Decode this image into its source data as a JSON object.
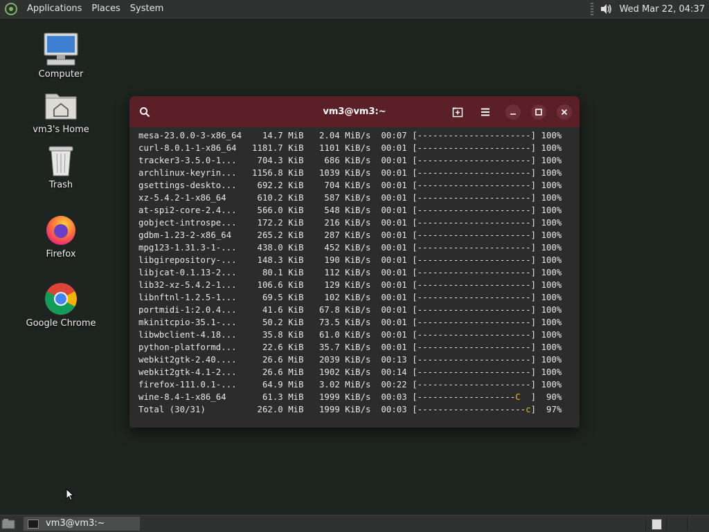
{
  "top_panel": {
    "menus": [
      "Applications",
      "Places",
      "System"
    ],
    "clock": "Wed Mar 22, 04:37"
  },
  "desktop": {
    "icons": [
      {
        "label": "Computer",
        "icon": "computer-icon"
      },
      {
        "label": "vm3's Home",
        "icon": "home-folder-icon"
      },
      {
        "label": "Trash",
        "icon": "trash-icon"
      },
      {
        "label": "Firefox",
        "icon": "firefox-icon"
      },
      {
        "label": "Google Chrome",
        "icon": "chrome-icon"
      }
    ]
  },
  "terminal": {
    "title": "vm3@vm3:~",
    "header_color": "#5b1f27",
    "rows": [
      {
        "name": "mesa-23.0.0-3-x86_64",
        "size": "14.7 MiB",
        "rate": "2.04 MiB/s",
        "time": "00:07",
        "bar": "[----------------------]",
        "pct": "100%"
      },
      {
        "name": "curl-8.0.1-1-x86_64",
        "size": "1181.7 KiB",
        "rate": "1101 KiB/s",
        "time": "00:01",
        "bar": "[----------------------]",
        "pct": "100%"
      },
      {
        "name": "tracker3-3.5.0-1...",
        "size": "704.3 KiB",
        "rate": "686 KiB/s",
        "time": "00:01",
        "bar": "[----------------------]",
        "pct": "100%"
      },
      {
        "name": "archlinux-keyrin...",
        "size": "1156.8 KiB",
        "rate": "1039 KiB/s",
        "time": "00:01",
        "bar": "[----------------------]",
        "pct": "100%"
      },
      {
        "name": "gsettings-deskto...",
        "size": "692.2 KiB",
        "rate": "704 KiB/s",
        "time": "00:01",
        "bar": "[----------------------]",
        "pct": "100%"
      },
      {
        "name": "xz-5.4.2-1-x86_64",
        "size": "610.2 KiB",
        "rate": "587 KiB/s",
        "time": "00:01",
        "bar": "[----------------------]",
        "pct": "100%"
      },
      {
        "name": "at-spi2-core-2.4...",
        "size": "566.0 KiB",
        "rate": "548 KiB/s",
        "time": "00:01",
        "bar": "[----------------------]",
        "pct": "100%"
      },
      {
        "name": "gobject-introspe...",
        "size": "172.2 KiB",
        "rate": "216 KiB/s",
        "time": "00:01",
        "bar": "[----------------------]",
        "pct": "100%"
      },
      {
        "name": "gdbm-1.23-2-x86_64",
        "size": "265.2 KiB",
        "rate": "287 KiB/s",
        "time": "00:01",
        "bar": "[----------------------]",
        "pct": "100%"
      },
      {
        "name": "mpg123-1.31.3-1-...",
        "size": "438.0 KiB",
        "rate": "452 KiB/s",
        "time": "00:01",
        "bar": "[----------------------]",
        "pct": "100%"
      },
      {
        "name": "libgirepository-...",
        "size": "148.3 KiB",
        "rate": "190 KiB/s",
        "time": "00:01",
        "bar": "[----------------------]",
        "pct": "100%"
      },
      {
        "name": "libjcat-0.1.13-2...",
        "size": "80.1 KiB",
        "rate": "112 KiB/s",
        "time": "00:01",
        "bar": "[----------------------]",
        "pct": "100%"
      },
      {
        "name": "lib32-xz-5.4.2-1...",
        "size": "106.6 KiB",
        "rate": "129 KiB/s",
        "time": "00:01",
        "bar": "[----------------------]",
        "pct": "100%"
      },
      {
        "name": "libnftnl-1.2.5-1...",
        "size": "69.5 KiB",
        "rate": "102 KiB/s",
        "time": "00:01",
        "bar": "[----------------------]",
        "pct": "100%"
      },
      {
        "name": "portmidi-1:2.0.4...",
        "size": "41.6 KiB",
        "rate": "67.8 KiB/s",
        "time": "00:01",
        "bar": "[----------------------]",
        "pct": "100%"
      },
      {
        "name": "mkinitcpio-35.1-...",
        "size": "50.2 KiB",
        "rate": "73.5 KiB/s",
        "time": "00:01",
        "bar": "[----------------------]",
        "pct": "100%"
      },
      {
        "name": "libwbclient-4.18...",
        "size": "35.8 KiB",
        "rate": "61.0 KiB/s",
        "time": "00:01",
        "bar": "[----------------------]",
        "pct": "100%"
      },
      {
        "name": "python-platformd...",
        "size": "22.6 KiB",
        "rate": "35.7 KiB/s",
        "time": "00:01",
        "bar": "[----------------------]",
        "pct": "100%"
      },
      {
        "name": "webkit2gtk-2.40....",
        "size": "26.6 MiB",
        "rate": "2039 KiB/s",
        "time": "00:13",
        "bar": "[----------------------]",
        "pct": "100%"
      },
      {
        "name": "webkit2gtk-4.1-2...",
        "size": "26.6 MiB",
        "rate": "1902 KiB/s",
        "time": "00:14",
        "bar": "[----------------------]",
        "pct": "100%"
      },
      {
        "name": "firefox-111.0.1-...",
        "size": "64.9 MiB",
        "rate": "3.02 MiB/s",
        "time": "00:22",
        "bar": "[----------------------]",
        "pct": "100%"
      },
      {
        "name": "wine-8.4-1-x86_64",
        "size": "61.3 MiB",
        "rate": "1999 KiB/s",
        "time": "00:03",
        "bar": "[-------------------",
        "bar_marker": "C",
        "bar_tail": "  ]",
        "pct": "90%"
      },
      {
        "name": "Total (30/31)",
        "size": "262.0 MiB",
        "rate": "1999 KiB/s",
        "time": "00:03",
        "bar": "[---------------------",
        "bar_marker": "c",
        "bar_tail": "]",
        "pct": "97%"
      }
    ]
  },
  "bottom_panel": {
    "task_label": "vm3@vm3:~"
  }
}
